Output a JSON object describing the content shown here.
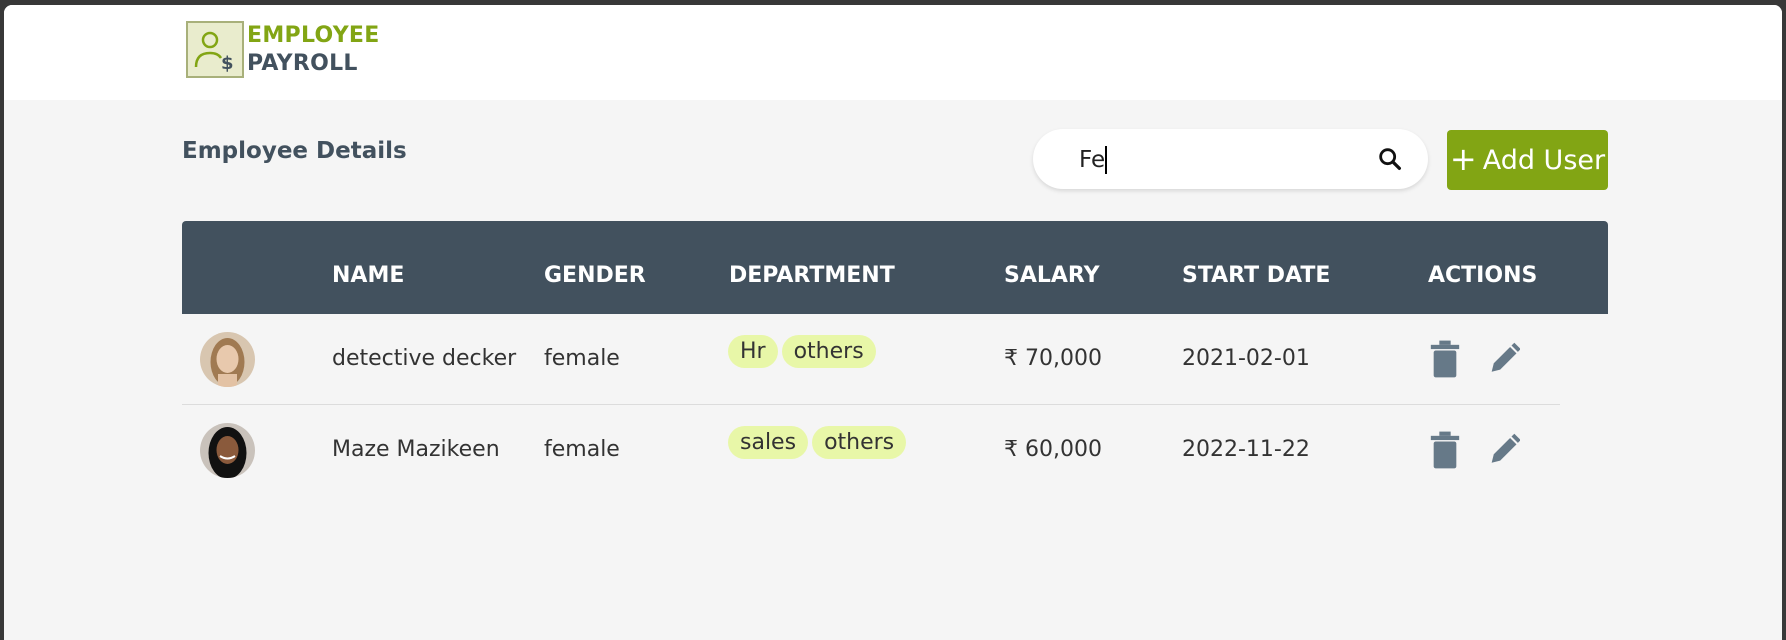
{
  "app": {
    "logo_line1": "EMPLOYEE",
    "logo_line2": "PAYROLL",
    "brand_color": "#82a514",
    "dark_color": "#42515e"
  },
  "page": {
    "title": "Employee Details"
  },
  "search": {
    "value": "Fe",
    "icon": "search-icon"
  },
  "toolbar": {
    "add_label": "Add User",
    "add_icon": "+"
  },
  "table": {
    "headers": [
      "NAME",
      "GENDER",
      "DEPARTMENT",
      "SALARY",
      "START DATE",
      "ACTIONS"
    ],
    "rows": [
      {
        "name": "detective decker",
        "gender": "female",
        "departments": [
          "Hr",
          "others"
        ],
        "salary": "₹ 70,000",
        "start_date": "2021-02-01",
        "avatar": "avatar-woman-blonde"
      },
      {
        "name": "Maze Mazikeen",
        "gender": "female",
        "departments": [
          "sales",
          "others"
        ],
        "salary": "₹ 60,000",
        "start_date": "2022-11-22",
        "avatar": "avatar-woman-dark-hair"
      }
    ],
    "action_icons": [
      "delete-icon",
      "edit-icon"
    ]
  }
}
